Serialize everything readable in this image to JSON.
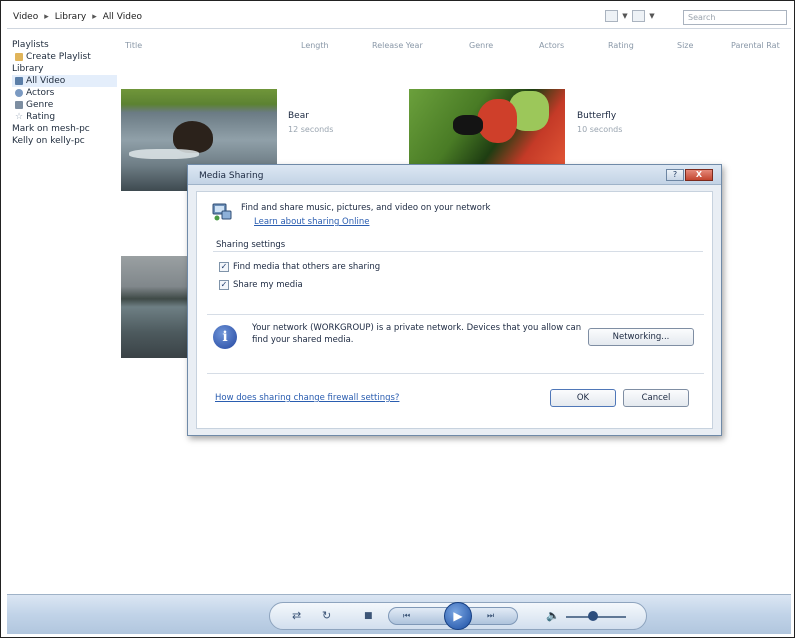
{
  "breadcrumb": [
    "Video",
    "Library",
    "All Video"
  ],
  "search": {
    "placeholder": "Search"
  },
  "nav": {
    "playlists_label": "Playlists",
    "create_playlist": "Create Playlist",
    "library_label": "Library",
    "items": [
      "All Video",
      "Actors",
      "Genre",
      "Rating"
    ],
    "selected": "All Video",
    "shared_libraries": [
      "Mark on mesh-pc",
      "Kelly on kelly-pc"
    ]
  },
  "columns": [
    "Title",
    "Length",
    "Release Year",
    "Genre",
    "Actors",
    "Rating",
    "Size",
    "Parental Rat"
  ],
  "videos": [
    {
      "title": "Bear",
      "length": "12 seconds"
    },
    {
      "title": "Butterfly",
      "length": "10 seconds"
    }
  ],
  "dialog": {
    "title": "Media Sharing",
    "help_icon": "?",
    "close_icon": "X",
    "intro": "Find and share music, pictures, and video on your network",
    "learn_link": "Learn about sharing Online",
    "group_label": "Sharing settings",
    "options": [
      {
        "label": "Find media that others are sharing",
        "checked": true
      },
      {
        "label": "Share my media",
        "checked": true
      }
    ],
    "network_text": "Your network (WORKGROUP) is a private network. Devices that you allow can find your shared media.",
    "networking_button": "Networking...",
    "firewall_link": "How does sharing change firewall settings?",
    "ok_button": "OK",
    "cancel_button": "Cancel"
  },
  "player": {
    "shuffle": "⇄",
    "repeat": "↻",
    "stop": "■",
    "previous": "⏮",
    "play": "▶",
    "next": "⏭",
    "volume": "🔈",
    "volume_level": 0.45
  }
}
